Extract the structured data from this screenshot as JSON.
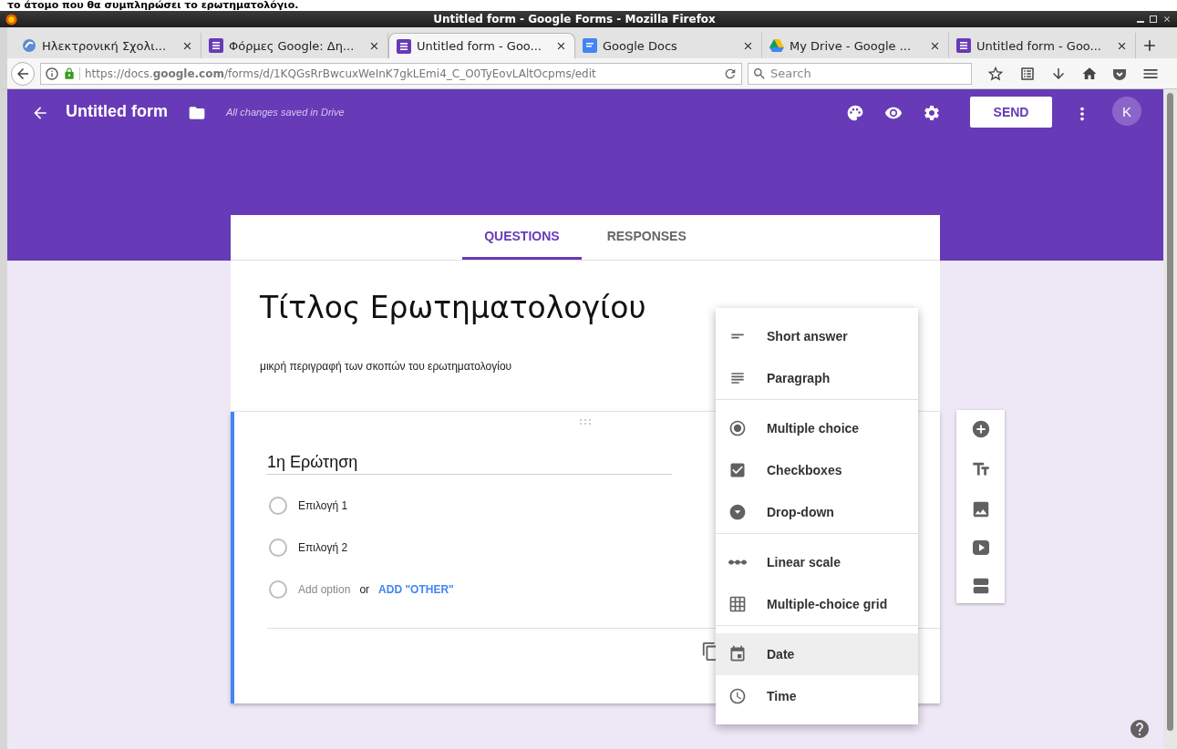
{
  "caption": "το άτομο που θα συμπληρώσει το ερωτηματολόγιο.",
  "window": {
    "title": "Untitled form - Google Forms - Mozilla Firefox"
  },
  "browser_tabs": [
    {
      "label": "Ηλεκτρονική Σχολι...",
      "kind": "school",
      "selected": false
    },
    {
      "label": "Φόρμες Google: Δη...",
      "kind": "forms",
      "selected": false
    },
    {
      "label": "Untitled form - Goo...",
      "kind": "forms",
      "selected": true
    },
    {
      "label": "Google Docs",
      "kind": "docs",
      "selected": false
    },
    {
      "label": "My Drive - Google ...",
      "kind": "drive",
      "selected": false
    },
    {
      "label": "Untitled form - Goo...",
      "kind": "forms",
      "selected": false
    }
  ],
  "address_bar": {
    "url": "https://docs.**google.com**/forms/d/1KQGsRrBwcuxWeInK7gkLEmi4_C_O0TyEovLAltOcpms/edit"
  },
  "search": {
    "placeholder": "Search"
  },
  "header": {
    "title": "Untitled form",
    "status": "All changes saved in Drive",
    "send": "SEND",
    "avatar": "K"
  },
  "form_tabs": [
    {
      "label": "QUESTIONS",
      "selected": true
    },
    {
      "label": "RESPONSES",
      "selected": false
    }
  ],
  "form": {
    "title": "Τίτλος Ερωτηματολογίου",
    "description": "μικρή περιγραφή των σκοπών του ερωτηματολογίου"
  },
  "question": {
    "title": "1η Ερώτηση",
    "options": [
      {
        "label": "Επιλογή 1",
        "selected": false
      },
      {
        "label": "Επιλογή 2",
        "selected": false
      }
    ],
    "add_option": {
      "selected": false,
      "placeholder": "Add option",
      "joiner": "or",
      "link": "ADD \"OTHER\""
    }
  },
  "type_menu": {
    "groups": [
      {
        "items": [
          {
            "label": "Short answer",
            "kind": "short",
            "highlighted": false
          },
          {
            "label": "Paragraph",
            "kind": "paragraph",
            "highlighted": false
          }
        ]
      },
      {
        "items": [
          {
            "label": "Multiple choice",
            "kind": "radio",
            "highlighted": false
          },
          {
            "label": "Checkboxes",
            "kind": "checkbox",
            "highlighted": false
          },
          {
            "label": "Drop-down",
            "kind": "dropdown",
            "highlighted": false
          }
        ]
      },
      {
        "items": [
          {
            "label": "Linear scale",
            "kind": "scale",
            "highlighted": false
          },
          {
            "label": "Multiple-choice grid",
            "kind": "grid",
            "highlighted": false
          }
        ]
      },
      {
        "items": [
          {
            "label": "Date",
            "kind": "date",
            "highlighted": true
          },
          {
            "label": "Time",
            "kind": "time",
            "highlighted": false
          }
        ]
      }
    ]
  }
}
